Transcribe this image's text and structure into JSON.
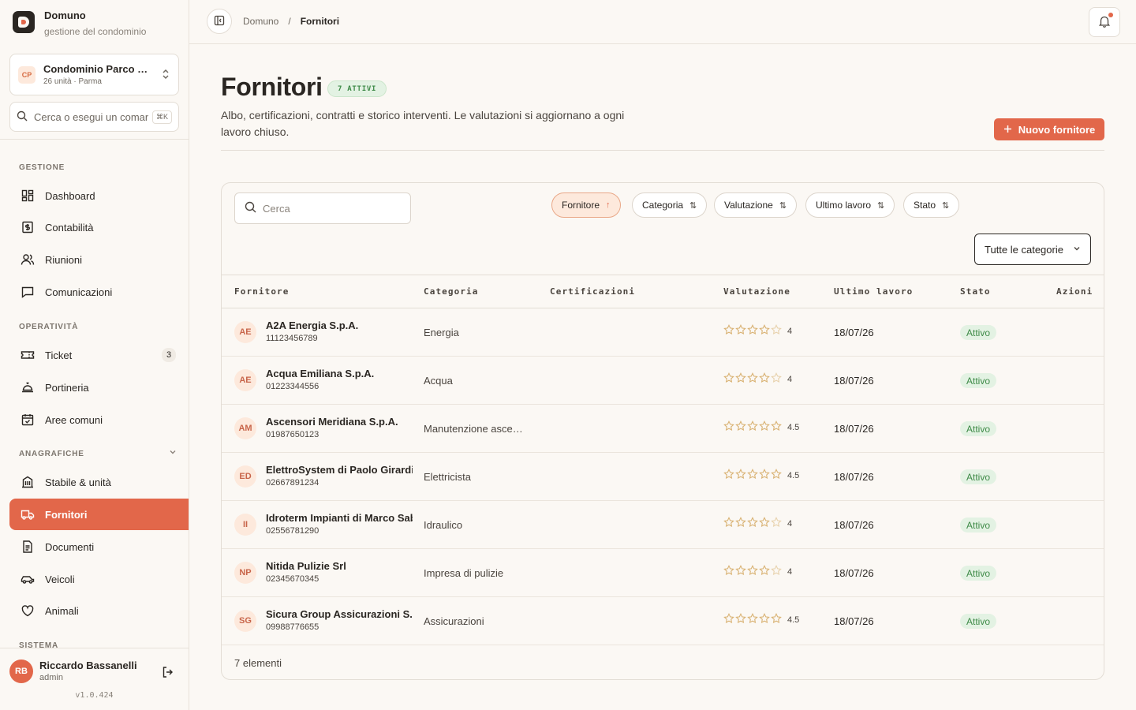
{
  "brand": {
    "name": "Domuno",
    "subtitle": "gestione del condominio"
  },
  "condo": {
    "badge": "CP",
    "name": "Condominio Parco dei Tigli",
    "sub": "26 unità · Parma"
  },
  "command": {
    "placeholder": "Cerca o esegui un comando",
    "kbd": "⌘K"
  },
  "nav": {
    "sections": [
      "Gestione",
      "Operatività",
      "Anagrafiche",
      "Sistema"
    ],
    "items": [
      {
        "label": "Dashboard",
        "icon": "dashboard-icon"
      },
      {
        "label": "Contabilità",
        "icon": "accounting-icon"
      },
      {
        "label": "Riunioni",
        "icon": "people-icon"
      },
      {
        "label": "Comunicazioni",
        "icon": "chat-icon"
      },
      {
        "label": "Ticket",
        "icon": "ticket-icon",
        "badge": "3"
      },
      {
        "label": "Portineria",
        "icon": "concierge-icon"
      },
      {
        "label": "Aree comuni",
        "icon": "calendar-icon"
      },
      {
        "label": "Stabile & unità",
        "icon": "building-icon"
      },
      {
        "label": "Fornitori",
        "icon": "truck-icon",
        "active": true
      },
      {
        "label": "Documenti",
        "icon": "document-icon"
      },
      {
        "label": "Veicoli",
        "icon": "car-icon"
      },
      {
        "label": "Animali",
        "icon": "heart-icon"
      }
    ]
  },
  "user": {
    "initials": "RB",
    "name": "Riccardo Bassanelli",
    "role": "admin",
    "version": "v1.0.424"
  },
  "breadcrumb": {
    "root": "Domuno",
    "sep": "/",
    "current": "Fornitori"
  },
  "page": {
    "title": "Fornitori",
    "active_badge": "7 ATTIVI",
    "description": "Albo, certificazioni, contratti e storico interventi. Le valutazioni si aggiornano a ogni lavoro chiuso.",
    "new_button": "Nuovo fornitore"
  },
  "toolbar": {
    "search_placeholder": "Cerca",
    "sorts": [
      {
        "label": "Fornitore",
        "active": true,
        "arrow": "↑"
      },
      {
        "label": "Categoria",
        "arrow": "⇅"
      },
      {
        "label": "Valutazione",
        "arrow": "⇅"
      },
      {
        "label": "Ultimo lavoro",
        "arrow": "⇅"
      },
      {
        "label": "Stato",
        "arrow": "⇅"
      }
    ],
    "category_filter": "Tutte le categorie"
  },
  "table": {
    "columns": [
      "Fornitore",
      "Categoria",
      "Certificazioni",
      "Valutazione",
      "Ultimo lavoro",
      "Stato",
      "Azioni"
    ],
    "rows": [
      {
        "initials": "AE",
        "name": "A2A Energia S.p.A.",
        "vat": "11123456789",
        "category": "Energia",
        "rating": 4,
        "rating_label": "4",
        "last_job": "18/07/26",
        "status": "Attivo"
      },
      {
        "initials": "AE",
        "name": "Acqua Emiliana S.p.A.",
        "vat": "01223344556",
        "category": "Acqua",
        "rating": 4,
        "rating_label": "4",
        "last_job": "18/07/26",
        "status": "Attivo"
      },
      {
        "initials": "AM",
        "name": "Ascensori Meridiana S.p.A.",
        "vat": "01987650123",
        "category": "Manutenzione ascensori",
        "rating": 4.5,
        "rating_label": "4.5",
        "last_job": "18/07/26",
        "status": "Attivo"
      },
      {
        "initials": "ED",
        "name": "ElettroSystem di Paolo Girardi",
        "vat": "02667891234",
        "category": "Elettricista",
        "rating": 4.5,
        "rating_label": "4.5",
        "last_job": "18/07/26",
        "status": "Attivo"
      },
      {
        "initials": "II",
        "name": "Idroterm Impianti di Marco Sabatini",
        "vat": "02556781290",
        "category": "Idraulico",
        "rating": 4,
        "rating_label": "4",
        "last_job": "18/07/26",
        "status": "Attivo"
      },
      {
        "initials": "NP",
        "name": "Nitida Pulizie Srl",
        "vat": "02345670345",
        "category": "Impresa di pulizie",
        "rating": 4,
        "rating_label": "4",
        "last_job": "18/07/26",
        "status": "Attivo"
      },
      {
        "initials": "SG",
        "name": "Sicura Group Assicurazioni S.p.A.",
        "vat": "09988776655",
        "category": "Assicurazioni",
        "rating": 4.5,
        "rating_label": "4.5",
        "last_job": "18/07/26",
        "status": "Attivo"
      }
    ],
    "count_label": "7 elementi"
  },
  "colors": {
    "accent": "#e2674a",
    "success": "#3e8a47",
    "star": "#d9b273"
  }
}
